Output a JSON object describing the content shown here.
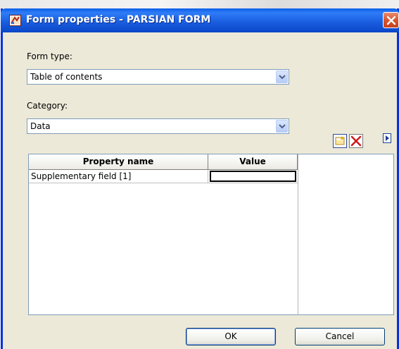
{
  "window": {
    "title": "Form properties - PARSIAN FORM",
    "icon": "form-app-icon",
    "close_icon": "close-icon"
  },
  "form_type": {
    "label": "Form type:",
    "selected": "Table of contents"
  },
  "category": {
    "label": "Category:",
    "selected": "Data"
  },
  "toolbar": {
    "new_icon": "new-row-icon",
    "delete_icon": "delete-icon",
    "expand_icon": "expand-arrow-icon"
  },
  "grid": {
    "columns": [
      "Property name",
      "Value"
    ],
    "rows": [
      {
        "name": "Supplementary field [1]",
        "value": ""
      }
    ]
  },
  "buttons": {
    "ok": "OK",
    "cancel": "Cancel"
  },
  "colors": {
    "titlebar": "#0a5de8",
    "close_button": "#d8552f",
    "dialog_background": "#ece9d8"
  }
}
